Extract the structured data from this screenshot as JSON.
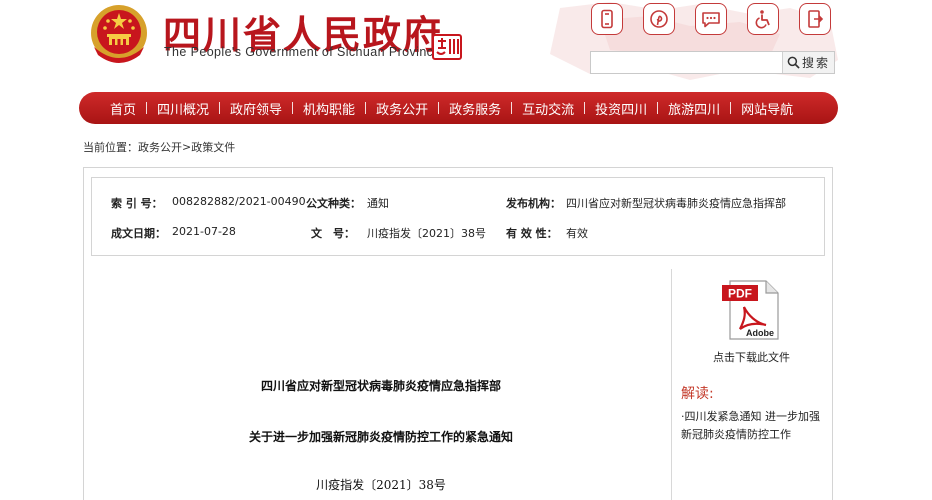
{
  "header": {
    "title": "四川省人民政府",
    "subtitle": "The People's Government of Sichuan Province",
    "emblem_icon": "national-emblem-icon",
    "seal_icon": "china-sichuan-seal-icon",
    "tools": [
      {
        "name": "mobile-icon"
      },
      {
        "name": "pinterest-icon"
      },
      {
        "name": "message-icon"
      },
      {
        "name": "accessibility-icon"
      },
      {
        "name": "exit-icon"
      }
    ],
    "search": {
      "placeholder": "",
      "value": "",
      "button_label": "搜索"
    }
  },
  "nav": {
    "items": [
      "首页",
      "四川概况",
      "政府领导",
      "机构职能",
      "政务公开",
      "政务服务",
      "互动交流",
      "投资四川",
      "旅游四川",
      "网站导航"
    ]
  },
  "breadcrumb": {
    "prefix": "当前位置：",
    "items": [
      "政务公开",
      "政策文件"
    ],
    "separator": ">"
  },
  "meta": {
    "index_label": "索 引 号：",
    "index_value": "008282882/2021-00490",
    "category_label": "公文种类：",
    "category_value": "通知",
    "publisher_label": "发布机构：",
    "publisher_value": "四川省应对新型冠状病毒肺炎疫情应急指挥部",
    "date_label": "成文日期：",
    "date_value": "2021-07-28",
    "number_label": "文　号：",
    "number_value": "川疫指发〔2021〕38号",
    "validity_label": "有 效 性：",
    "validity_value": "有效"
  },
  "sidebar": {
    "pdf_label": "PDF",
    "pdf_brand": "Adobe",
    "download_label": "点击下载此文件",
    "jiedu_title": "解读:",
    "jiedu_link": "·四川发紧急通知 进一步加强新冠肺炎疫情防控工作"
  },
  "document": {
    "issuer": "四川省应对新型冠状病毒肺炎疫情应急指挥部",
    "title": "关于进一步加强新冠肺炎疫情防控工作的紧急通知",
    "number": "川疫指发〔2021〕38号"
  },
  "colors": {
    "brand_red": "#b8161d",
    "nav_red": "#c01e1e",
    "link_red": "#c43a2a"
  }
}
